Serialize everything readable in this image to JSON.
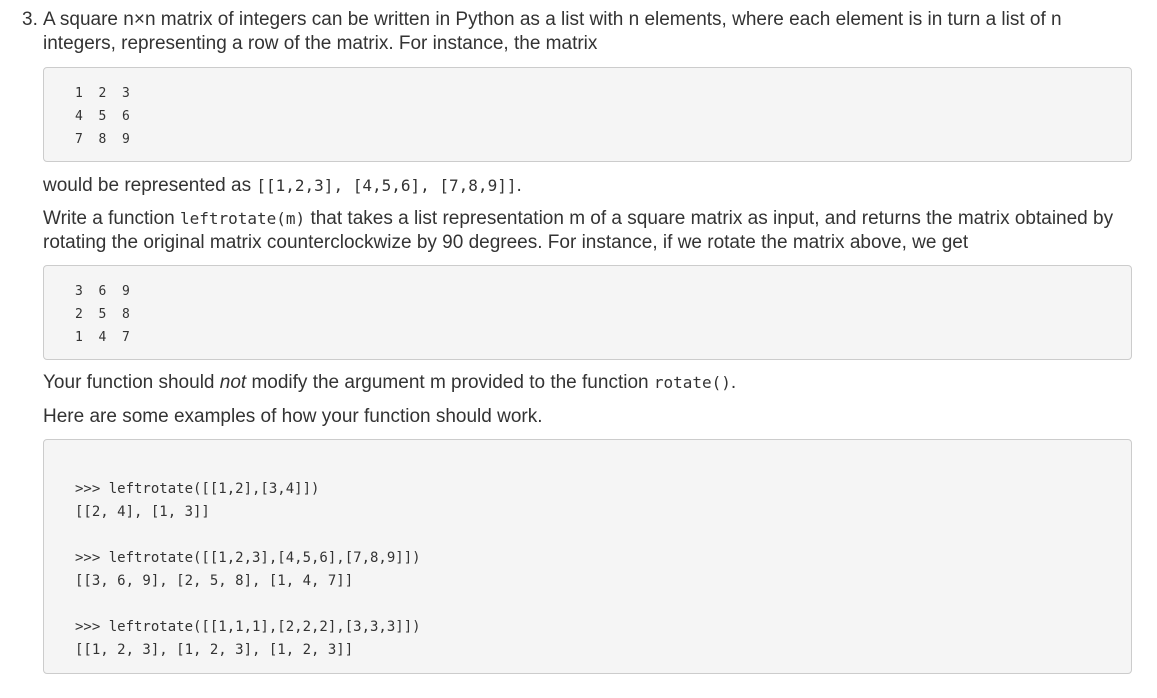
{
  "question": {
    "number": "3.",
    "intro": "A square n×n matrix of integers can be written in Python as a list with n elements, where each element is in turn a list of n integers, representing a row of the matrix. For instance, the matrix",
    "matrix_rows": [
      "1  2  3",
      "4  5  6",
      "7  8  9"
    ],
    "represented_prefix": "would be represented as ",
    "represented_code": "[[1,2,3], [4,5,6], [7,8,9]]",
    "represented_suffix": ".",
    "write_prefix": "Write a function ",
    "function_signature": "leftrotate(m)",
    "write_suffix": " that takes a list representation m of a square matrix as input, and returns the matrix obtained by rotating the original matrix counterclockwize by 90 degrees. For instance, if we rotate the matrix above, we get",
    "rotated_rows": [
      "3  6  9",
      "2  5  8",
      "1  4  7"
    ],
    "note_prefix": "Your function should ",
    "note_emphasis": "not",
    "note_middle": " modify the argument m provided to the function ",
    "note_code": "rotate()",
    "note_suffix": ".",
    "examples_intro": "Here are some examples of how your function should work.",
    "examples": [
      {
        "call": ">>> leftrotate([[1,2],[3,4]])",
        "result": "[[2, 4], [1, 3]]"
      },
      {
        "call": ">>> leftrotate([[1,2,3],[4,5,6],[7,8,9]])",
        "result": "[[3, 6, 9], [2, 5, 8], [1, 4, 7]]"
      },
      {
        "call": ">>> leftrotate([[1,1,1],[2,2,2],[3,3,3]])",
        "result": "[[1, 2, 3], [1, 2, 3], [1, 2, 3]]"
      }
    ]
  }
}
